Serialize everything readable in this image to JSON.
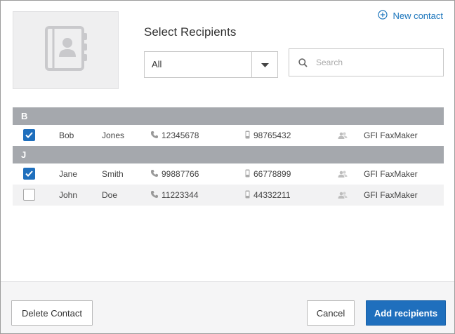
{
  "header": {
    "title": "Select Recipients",
    "new_contact_label": "New contact",
    "avatar_icon": "address-book-icon"
  },
  "filter": {
    "selected": "All"
  },
  "search": {
    "placeholder": "Search",
    "value": ""
  },
  "groups": [
    {
      "letter": "B",
      "rows": [
        {
          "checked": true,
          "first": "Bob",
          "last": "Jones",
          "phone": "12345678",
          "mobile": "98765432",
          "service": "GFI FaxMaker"
        }
      ]
    },
    {
      "letter": "J",
      "rows": [
        {
          "checked": true,
          "first": "Jane",
          "last": "Smith",
          "phone": "99887766",
          "mobile": "66778899",
          "service": "GFI FaxMaker"
        },
        {
          "checked": false,
          "first": "John",
          "last": "Doe",
          "phone": "11223344",
          "mobile": "44332211",
          "service": "GFI FaxMaker"
        }
      ]
    }
  ],
  "footer": {
    "delete_label": "Delete Contact",
    "cancel_label": "Cancel",
    "add_label": "Add recipients"
  },
  "colors": {
    "accent": "#1f6fbd",
    "group_header": "#a5a8ad",
    "link": "#1b75bc"
  }
}
